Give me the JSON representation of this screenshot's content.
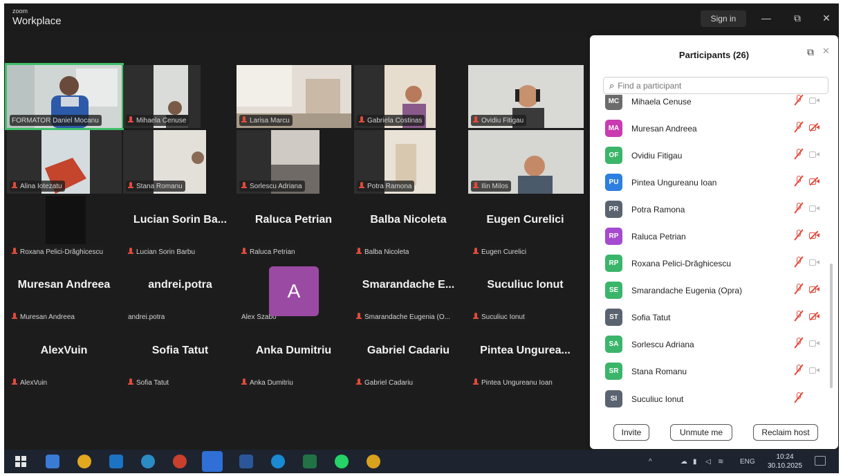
{
  "titlebar": {
    "brand_small": "zoom",
    "brand_big": "Workplace",
    "sign_in": "Sign in",
    "minimize": "—",
    "restore": "⧉",
    "close": "✕"
  },
  "gallery": {
    "video_tiles": [
      {
        "label": "FORMATOR Daniel Mocanu"
      },
      {
        "label": "Mihaela Cenuse"
      },
      {
        "label": "Larisa Marcu"
      },
      {
        "label": "Gabriela Costinas"
      },
      {
        "label": "Ovidiu Fitigau"
      },
      {
        "label": "Alina Iotezatu"
      },
      {
        "label": "Stana Romanu"
      },
      {
        "label": "Sorlescu Adriana"
      },
      {
        "label": "Potra Ramona"
      },
      {
        "label": "Ilin Milos"
      },
      {
        "label": "Roxana Pelici-Drăghicescu"
      }
    ],
    "name_tiles": [
      {
        "name": "Lucian Sorin Ba...",
        "label": "Lucian Sorin Barbu"
      },
      {
        "name": "Raluca Petrian",
        "label": "Raluca Petrian"
      },
      {
        "name": "Balba Nicoleta",
        "label": "Balba Nicoleta"
      },
      {
        "name": "Eugen Curelici",
        "label": "Eugen Curelici"
      },
      {
        "name": "Muresan Andreea",
        "label": "Muresan Andreea"
      },
      {
        "name": "andrei.potra",
        "label": "andrei.potra"
      },
      {
        "name": "",
        "label": "Alex Szabo"
      },
      {
        "name": "Smarandache E...",
        "label": "Smarandache Eugenia (O..."
      },
      {
        "name": "Suculiuc Ionut",
        "label": "Suculiuc Ionut"
      },
      {
        "name": "AlexVuin",
        "label": "AlexVuin"
      },
      {
        "name": "Sofia Tatut",
        "label": "Sofia Tatut"
      },
      {
        "name": "Anka Dumitriu",
        "label": "Anka Dumitriu"
      },
      {
        "name": "Gabriel Cadariu",
        "label": "Gabriel Cadariu"
      },
      {
        "name": "Pintea Ungurea...",
        "label": "Pintea Ungureanu Ioan"
      }
    ],
    "avatar_letter": "A"
  },
  "participants": {
    "title": "Participants (26)",
    "search_placeholder": "Find a participant",
    "search_icon": "search-icon",
    "list": [
      {
        "initials": "MC",
        "name": "Mihaela Cenuse",
        "color": "#6b6b6b",
        "cam": "on"
      },
      {
        "initials": "MA",
        "name": "Muresan Andreea",
        "color": "#c93bb0",
        "cam": "off"
      },
      {
        "initials": "OF",
        "name": "Ovidiu Fitigau",
        "color": "#3bb56a",
        "cam": "on"
      },
      {
        "initials": "PU",
        "name": "Pintea Ungureanu Ioan",
        "color": "#2d7fe0",
        "cam": "off"
      },
      {
        "initials": "PR",
        "name": "Potra Ramona",
        "color": "#5a6470",
        "cam": "on"
      },
      {
        "initials": "RP",
        "name": "Raluca Petrian",
        "color": "#a54bd0",
        "cam": "off"
      },
      {
        "initials": "RP",
        "name": "Roxana Pelici-Drăghicescu",
        "color": "#3bb56a",
        "cam": "on"
      },
      {
        "initials": "SE",
        "name": "Smarandache Eugenia (Opra)",
        "color": "#3bb56a",
        "cam": "off"
      },
      {
        "initials": "ST",
        "name": "Sofia Tatut",
        "color": "#5a6470",
        "cam": "off"
      },
      {
        "initials": "SA",
        "name": "Sorlescu Adriana",
        "color": "#3bb56a",
        "cam": "on"
      },
      {
        "initials": "SR",
        "name": "Stana Romanu",
        "color": "#3bb56a",
        "cam": "on"
      },
      {
        "initials": "SI",
        "name": "Suculiuc Ionut",
        "color": "#5a6470",
        "cam": "none"
      }
    ],
    "invite": "Invite",
    "unmute": "Unmute me",
    "reclaim": "Reclaim host"
  },
  "taskbar": {
    "language": "ENG",
    "time": "10:24",
    "date": "30.10.2025"
  }
}
